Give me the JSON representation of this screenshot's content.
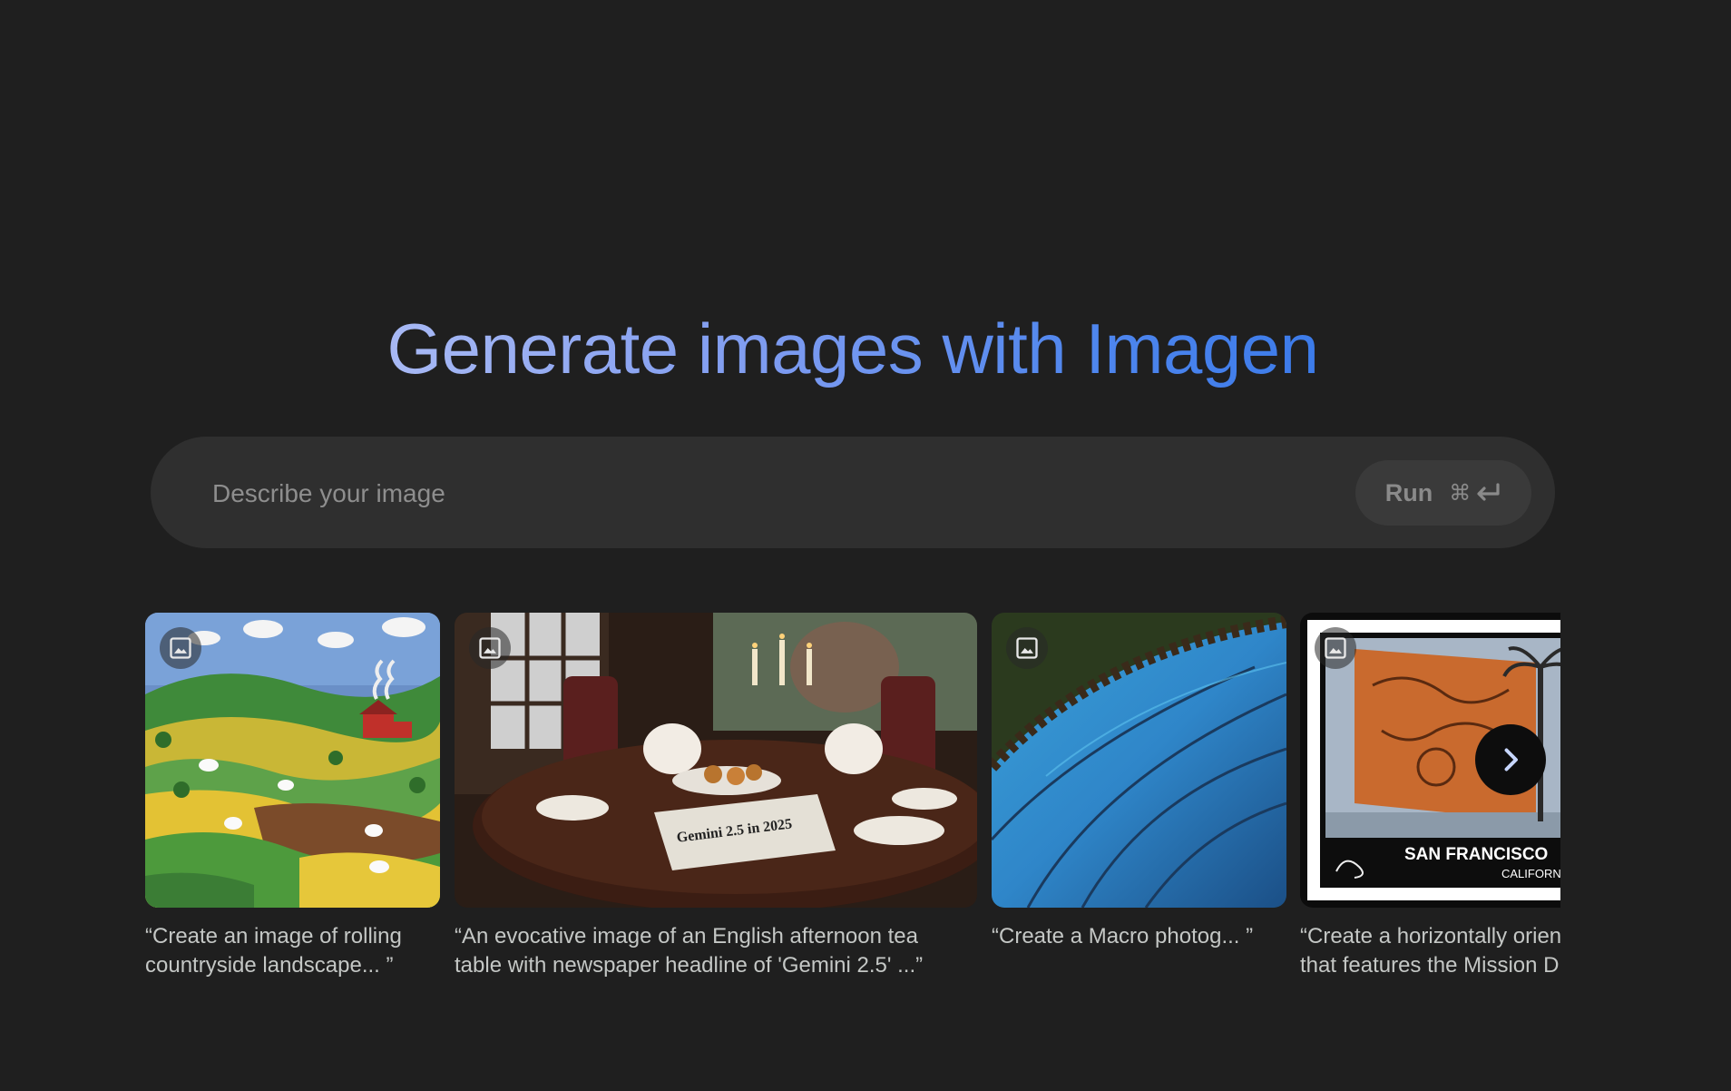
{
  "headline": "Generate images with Imagen",
  "prompt": {
    "placeholder": "Describe your image",
    "value": "",
    "run_label": "Run",
    "shortcut_cmd": "⌘",
    "shortcut_enter": "↵"
  },
  "gallery": {
    "items": [
      {
        "caption": "“Create an image of rolling\ncountryside landscape... ”",
        "icon": "image-icon"
      },
      {
        "caption": "“An evocative image of an English afternoon tea\ntable with newspaper headline of 'Gemini 2.5' ...”",
        "icon": "image-icon",
        "headline_text": "Gemini 2.5 in 2025"
      },
      {
        "caption": "“Create a Macro photog... ”",
        "icon": "image-icon"
      },
      {
        "caption": "“Create a horizontally orien\nthat features the Mission D",
        "icon": "image-icon",
        "stamp_city": "SAN FRANCISCO",
        "stamp_state": "CALIFORNIA"
      }
    ],
    "next_icon": "chevron-right-icon"
  },
  "colors": {
    "background": "#1f1f1f",
    "prompt_bar": "#2f2f2f",
    "headline_gradient_start": "#a8b9f4",
    "headline_gradient_end": "#3c7be9"
  }
}
